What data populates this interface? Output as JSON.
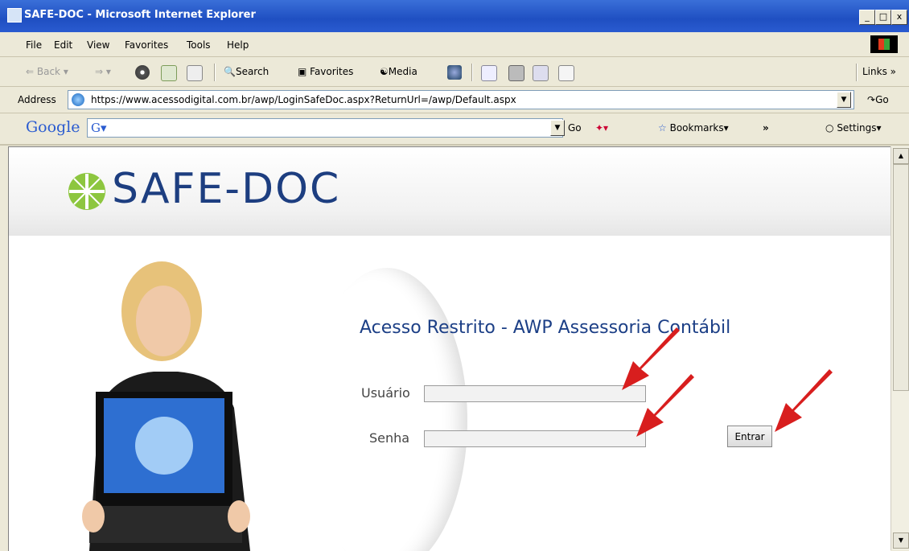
{
  "window": {
    "title": "SAFE-DOC - Microsoft Internet Explorer",
    "controls": [
      "_",
      "□",
      "x"
    ]
  },
  "menu": [
    "File",
    "Edit",
    "View",
    "Favorites",
    "Tools",
    "Help"
  ],
  "toolbar": {
    "back": "Back",
    "search": "Search",
    "favorites": "Favorites",
    "media": "Media",
    "links": "Links"
  },
  "address": {
    "label": "Address",
    "url": "https://www.acessodigital.com.br/awp/LoginSafeDoc.aspx?ReturnUrl=/awp/Default.aspx",
    "go": "Go"
  },
  "googlebar": {
    "logo": "Google",
    "go": "Go",
    "bookmarks": "Bookmarks",
    "settings": "Settings"
  },
  "page": {
    "logo_text": "SAFE-DOC",
    "heading": "Acesso Restrito - AWP Assessoria Contábil",
    "user_label": "Usuário",
    "password_label": "Senha",
    "submit": "Entrar"
  },
  "colors": {
    "brand_blue": "#1d3e80",
    "logo_green": "#8dc63f",
    "arrow_red": "#d81e1e",
    "title_blue": "#1f4fc2"
  }
}
